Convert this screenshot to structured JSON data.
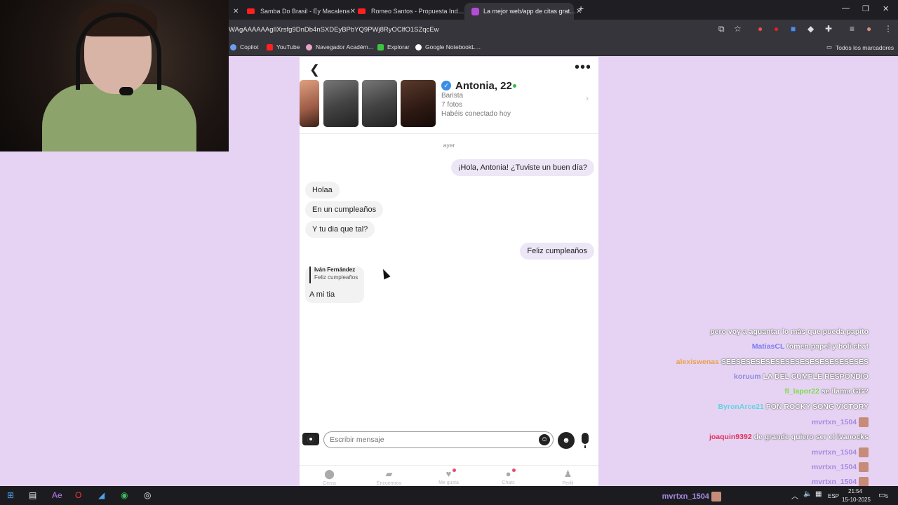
{
  "browser": {
    "tabs": [
      {
        "title": "Samba Do Brasil - Ey Macalena"
      },
      {
        "title": "Romeo Santos - Propuesta Ind…"
      },
      {
        "title": "La mejor web/app de citas grat…"
      }
    ],
    "url": "WAgAAAAAAgIlXrsfg9DnDb4nSXDEyBPbYQ9PWj8RyOClfO1SZqcEw",
    "bookmarks": [
      "Copilot",
      "YouTube",
      "Navegador Académ…",
      "Explorar",
      "Google NotebookL…"
    ],
    "all_bookmarks": "Todos los marcadores"
  },
  "profile": {
    "name": "Antonia, 22",
    "job": "Barista",
    "photos": "7 fotos",
    "connected": "Habéis conectado hoy"
  },
  "conversation": {
    "day": "ayer",
    "messages": [
      {
        "dir": "out",
        "text": "¡Hola, Antonia! ¿Tuviste un buen día?"
      },
      {
        "dir": "in",
        "text": "Holaa"
      },
      {
        "dir": "in",
        "text": "En un cumpleaños"
      },
      {
        "dir": "in",
        "text": "Y tu dia que tal?"
      },
      {
        "dir": "out",
        "text": "Feliz cumpleaños"
      }
    ],
    "reply": {
      "quoted_name": "Iván Fernández",
      "quoted_text": "Feliz cumpleaños",
      "text": "A mi tia"
    }
  },
  "composer": {
    "placeholder": "Escribir mensaje"
  },
  "nav": [
    {
      "label": "Cerca",
      "icon": "location-icon"
    },
    {
      "label": "Encuentros",
      "icon": "cards-icon"
    },
    {
      "label": "Me gusta",
      "icon": "heart-icon"
    },
    {
      "label": "Chats",
      "icon": "chat-icon"
    },
    {
      "label": "Perfil",
      "icon": "person-icon"
    }
  ],
  "stream_chat": [
    {
      "user": "",
      "text": "pero voy a aguantar lo más que pueda papito",
      "color": "#ffffff"
    },
    {
      "user": "MatiasCL",
      "text": "tomen papel y boli chat",
      "color": "#7c7cf0"
    },
    {
      "user": "alexiswenas",
      "text": "SEESESESESESESESESESESESESESES",
      "color": "#e6a24a"
    },
    {
      "user": "koruum",
      "text": "LA DEL CUMPLE RESPONDIO",
      "color": "#8a8ae0"
    },
    {
      "user": "fl_lapor22",
      "text": "se llama GG?",
      "color": "#7bdc4a"
    },
    {
      "user": "ByronArce21",
      "text": "PON ROCKY SONG VICTORY",
      "color": "#5fd3e0"
    },
    {
      "user": "mvrtxn_1504",
      "text": "",
      "color": "#a78ae0"
    },
    {
      "user": "joaquin9392",
      "text": "de grande quiero ser el ivanocks",
      "color": "#e0315a"
    },
    {
      "user": "mvrtxn_1504",
      "text": "",
      "color": "#a78ae0"
    },
    {
      "user": "mvrtxn_1504",
      "text": "",
      "color": "#a78ae0"
    },
    {
      "user": "mvrtxn_1504",
      "text": "",
      "color": "#a78ae0"
    },
    {
      "user": "mvrtxn_1504",
      "text": "",
      "color": "#a78ae0"
    }
  ],
  "taskbar": {
    "lang": "ESP",
    "time": "21:54",
    "date": "15-10-2025",
    "notif_count": "5"
  }
}
